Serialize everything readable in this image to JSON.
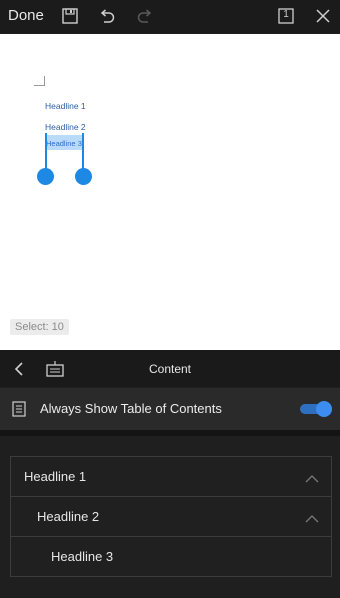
{
  "toolbar": {
    "done_label": "Done",
    "icons": [
      "save-icon",
      "undo-icon",
      "redo-icon",
      "page-count-icon",
      "close-icon"
    ],
    "page_count": "1"
  },
  "document": {
    "headlines": [
      "Headline 1",
      "Headline 2",
      "Headline 3"
    ],
    "selection_badge": "Select: 10"
  },
  "panel": {
    "title": "Content",
    "icons": [
      "back-icon",
      "keyboard-icon"
    ]
  },
  "toc_setting": {
    "label": "Always Show Table of Contents",
    "icon": "document-list-icon",
    "enabled": true
  },
  "headline_list": [
    {
      "label": "Headline 1",
      "expanded": true
    },
    {
      "label": "Headline 2",
      "expanded": true
    },
    {
      "label": "Headline 3",
      "expanded": false
    }
  ],
  "colors": {
    "accent": "#1e88e5",
    "toggle_on": "#3d8df0",
    "dark_bg": "#1f1f1f",
    "headline_text": "#2a5fa8"
  }
}
